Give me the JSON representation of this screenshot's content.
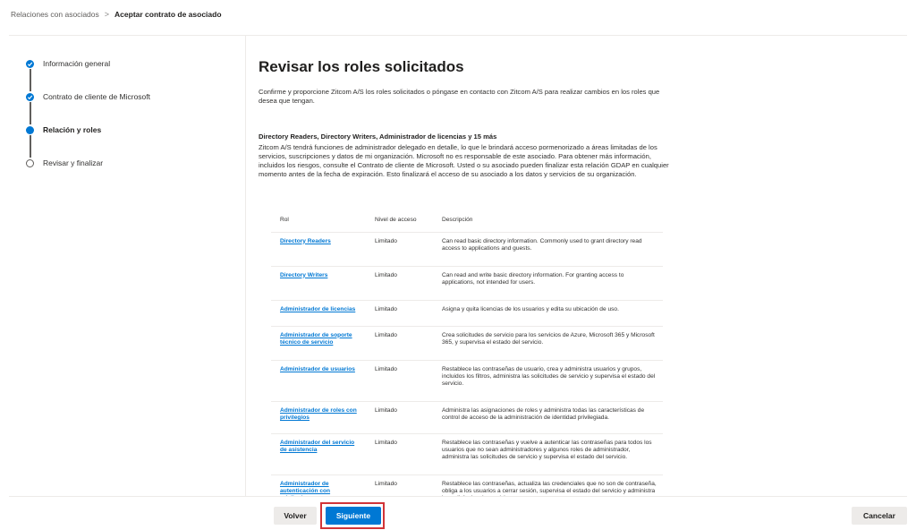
{
  "breadcrumb": {
    "parent": "Relaciones con asociados",
    "separator": ">",
    "current": "Aceptar contrato de asociado"
  },
  "steps": [
    {
      "label": "Información general",
      "state": "done"
    },
    {
      "label": "Contrato de cliente de Microsoft",
      "state": "done"
    },
    {
      "label": "Relación y roles",
      "state": "current"
    },
    {
      "label": "Revisar y finalizar",
      "state": "todo"
    }
  ],
  "main": {
    "title": "Revisar los roles solicitados",
    "intro": "Confirme y proporcione Zitcom A/S los roles solicitados o póngase en contacto con Zitcom A/S para realizar cambios en los roles que desea que tengan.",
    "section_title": "Directory Readers, Directory Writers, Administrador de licencias y 15 más",
    "description": "Zitcom A/S tendrá funciones de administrador delegado en detalle, lo que le brindará acceso pormenorizado a áreas limitadas de los servicios, suscripciones y datos de mi organización. Microsoft no es responsable de este asociado. Para obtener más información, incluidos los riesgos, consulte el Contrato de cliente de Microsoft. Usted o su asociado pueden finalizar esta relación GDAP en cualquier momento antes de la fecha de expiración. Esto finalizará el acceso de su asociado a los datos y servicios de su organización.",
    "table": {
      "headers": [
        "Rol",
        "Nivel de acceso",
        "Descripción"
      ],
      "rows": [
        {
          "role": "Directory Readers",
          "level": "Limitado",
          "desc": "Can read basic directory information. Commonly used to grant directory read access to applications and guests."
        },
        {
          "role": "Directory Writers",
          "level": "Limitado",
          "desc": "Can read and write basic directory information. For granting access to applications, not intended for users."
        },
        {
          "role": "Administrador de licencias",
          "level": "Limitado",
          "desc": "Asigna y quita licencias de los usuarios y edita su ubicación de uso."
        },
        {
          "role": "Administrador de soporte técnico de servicio",
          "level": "Limitado",
          "desc": "Crea solicitudes de servicio para los servicios de Azure, Microsoft 365 y Microsoft 365, y supervisa el estado del servicio."
        },
        {
          "role": "Administrador de usuarios",
          "level": "Limitado",
          "desc": "Restablece las contraseñas de usuario, crea y administra usuarios y grupos, incluidos los filtros, administra las solicitudes de servicio y supervisa el estado del servicio."
        },
        {
          "role": "Administrador de roles con privilegios",
          "level": "Limitado",
          "desc": "Administra las asignaciones de roles y administra todas las características de control de acceso de la administración de identidad privilegiada."
        },
        {
          "role": "Administrador del servicio de asistencia",
          "level": "Limitado",
          "desc": "Restablece las contraseñas y vuelve a autenticar las contraseñas para todos los usuarios que no sean administradores y algunos roles de administrador, administra las solicitudes de servicio y supervisa el estado del servicio."
        },
        {
          "role": "Administrador de autenticación con privilegios",
          "level": "Limitado",
          "desc": "Restablece las contraseñas, actualiza las credenciales que no son de contraseña, obliga a los usuarios a cerrar sesión, supervisa el estado del servicio y administra las solicitudes de servicio."
        }
      ]
    }
  },
  "footer": {
    "back_label": "Volver",
    "next_label": "Siguiente",
    "cancel_label": "Cancelar"
  },
  "colors": {
    "accent": "#0078d4",
    "highlight": "#d13438"
  }
}
